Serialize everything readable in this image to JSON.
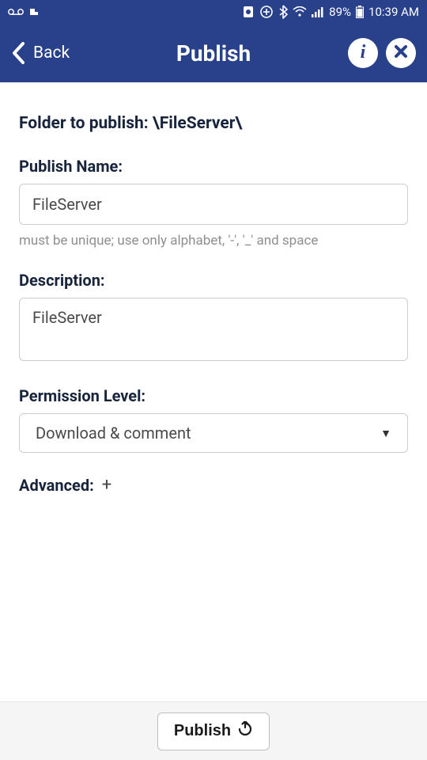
{
  "status": {
    "battery_text": "89%",
    "time": "10:39 AM"
  },
  "header": {
    "back_label": "Back",
    "title": "Publish"
  },
  "content": {
    "folder_prefix": "Folder to publish: ",
    "folder_path": "\\FileServer\\",
    "publish_name_label": "Publish Name:",
    "publish_name_value": "FileServer",
    "publish_name_hint": "must be unique; use only alphabet, '-', '_' and space",
    "description_label": "Description:",
    "description_value": "FileServer",
    "permission_label": "Permission Level:",
    "permission_selected": "Download & comment",
    "advanced_label": "Advanced:"
  },
  "footer": {
    "publish_btn": "Publish"
  }
}
